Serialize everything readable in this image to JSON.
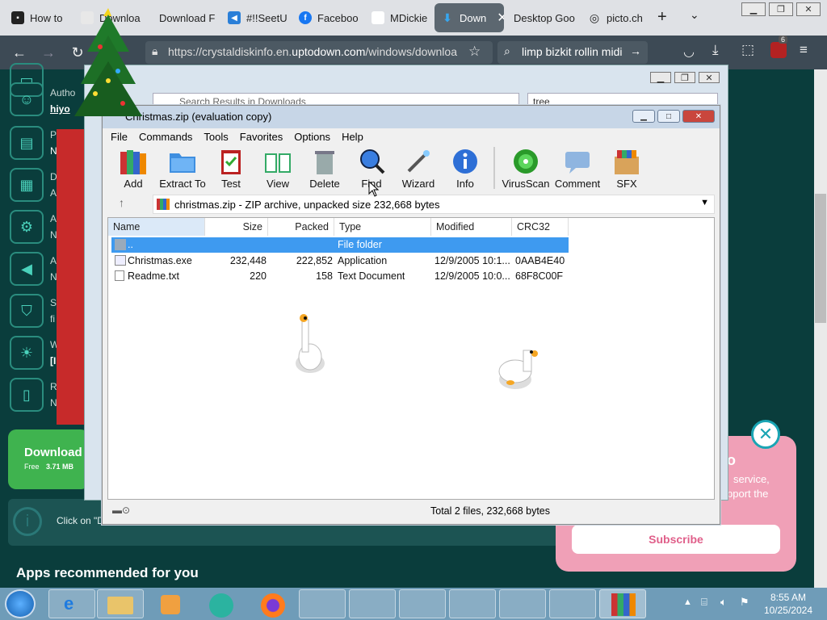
{
  "browser": {
    "tabs": [
      {
        "label": "How to",
        "icon": "page-icon"
      },
      {
        "label": "Download -",
        "icon": "page-icon"
      },
      {
        "label": "Download F",
        "icon": "page-icon"
      },
      {
        "label": "#!!SeetU",
        "icon": "chat-icon"
      },
      {
        "label": "Faceboo",
        "icon": "facebook-icon"
      },
      {
        "label": "MDickie",
        "icon": "page-icon"
      },
      {
        "label": "Down",
        "icon": "download-icon",
        "active": true
      },
      {
        "label": "Desktop Goo",
        "icon": "page-icon"
      },
      {
        "label": "picto.ch",
        "icon": "globe-icon"
      }
    ],
    "url_prefix": "https://crystaldiskinfo.en.",
    "url_domain": "uptodown.com",
    "url_suffix": "/windows/downloa",
    "search_text": "limp bizkit rollin midi",
    "ext_badge": "6"
  },
  "webpage": {
    "sidebar_labels": [
      "Autho",
      "hiyo",
      "P",
      "N",
      "D",
      "A",
      "A",
      "N",
      "A",
      "N",
      "S",
      "fi",
      "W",
      "[I",
      "R",
      "N"
    ],
    "download_label": "Download",
    "download_free": "Free",
    "download_size": "3.71 MB",
    "click_on": "Click on \"D",
    "apps_heading": "Apps recommended for you",
    "popup": {
      "heading_frag": "o",
      "line1": "service,",
      "line2": "pport the",
      "subscribe": "Subscribe"
    }
  },
  "explorer": {
    "search_placeholder": "Search Results in Downloads",
    "combo_value": "tree"
  },
  "winrar": {
    "title": "Christmas.zip (evaluation copy)",
    "menu": [
      "File",
      "Commands",
      "Tools",
      "Favorites",
      "Options",
      "Help"
    ],
    "toolbar": [
      "Add",
      "Extract To",
      "Test",
      "View",
      "Delete",
      "Find",
      "Wizard",
      "Info",
      "VirusScan",
      "Comment",
      "SFX"
    ],
    "path": "christmas.zip - ZIP archive, unpacked size 232,668 bytes",
    "columns": [
      "Name",
      "Size",
      "Packed",
      "Type",
      "Modified",
      "CRC32"
    ],
    "rows": [
      {
        "name": "..",
        "size": "",
        "packed": "",
        "type": "File folder",
        "modified": "",
        "crc": ""
      },
      {
        "name": "Christmas.exe",
        "size": "232,448",
        "packed": "222,852",
        "type": "Application",
        "modified": "12/9/2005 10:1...",
        "crc": "0AAB4E40"
      },
      {
        "name": "Readme.txt",
        "size": "220",
        "packed": "158",
        "type": "Text Document",
        "modified": "12/9/2005 10:0...",
        "crc": "68F8C00F"
      }
    ],
    "status": "Total 2 files, 232,668 bytes"
  },
  "taskbar": {
    "time": "8:55 AM",
    "date": "10/25/2024"
  },
  "colors": {
    "page_bg": "#0a3d3c",
    "download_green": "#3fb34f",
    "popup_pink": "#f0a0b7",
    "selection_blue": "#3e9af0"
  }
}
